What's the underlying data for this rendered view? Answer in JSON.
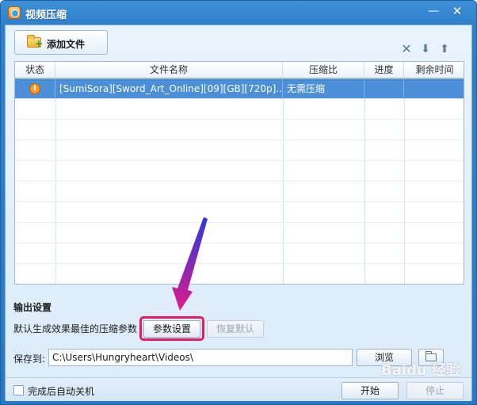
{
  "window": {
    "title": "视频压缩",
    "minimize_glyph": "—",
    "close_glyph": "✕"
  },
  "toolbar": {
    "add_file_label": "添加文件",
    "delete_glyph": "✕",
    "move_down_glyph": "⬇",
    "move_up_glyph": "⬆"
  },
  "table": {
    "columns": [
      "状态",
      "文件名称",
      "压缩比",
      "进度",
      "剩余时间"
    ],
    "rows": [
      {
        "status_icon": "warning-icon",
        "status_glyph": "!",
        "filename": "[SumiSora][Sword_Art_Online][09][GB][720p]....",
        "ratio": "无需压缩",
        "progress": "",
        "remaining": ""
      }
    ]
  },
  "output": {
    "section_title": "输出设置",
    "hint": "默认生成效果最佳的压缩参数",
    "params_button": "参数设置",
    "restore_button": "恢复默认",
    "save_label": "保存到:",
    "save_path": "C:\\Users\\Hungryheart\\Videos\\",
    "browse_button": "浏览"
  },
  "footer": {
    "auto_shutdown_label": "完成后自动关机",
    "start_button": "开始",
    "stop_button": "停止"
  },
  "watermark": "Baidu 经验",
  "colors": {
    "highlight": "#e8195e",
    "selected_row": "#4a8fd8",
    "title_bar": "#2f80cc"
  }
}
